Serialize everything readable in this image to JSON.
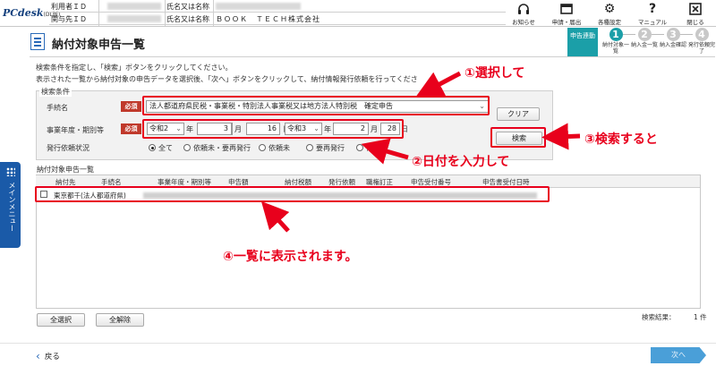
{
  "app": {
    "logo": "PCdesk",
    "logo_sub": "(DL版)"
  },
  "userinfo": {
    "row1_label": "利用者ＩＤ",
    "row1_name_label": "氏名又は名称",
    "row1_name_value": "",
    "row2_label": "関与先ＩＤ",
    "row2_name_label": "氏名又は名称",
    "row2_name_value": "ＢＯＯＫ　ＴＥＣＨ株式会社"
  },
  "toolbar": [
    {
      "label": "お知らせ",
      "icon": "headset-icon"
    },
    {
      "label": "申請・届出",
      "icon": "window-icon"
    },
    {
      "label": "各種設定",
      "icon": "gear-icon"
    },
    {
      "label": "マニュアル",
      "icon": "question-icon"
    },
    {
      "label": "閉じる",
      "icon": "close-icon"
    }
  ],
  "sidebar": {
    "tab_label": "メインメニュー"
  },
  "page": {
    "title": "納付対象申告一覧"
  },
  "steps": {
    "section_label": "申告連動",
    "items": [
      {
        "num": "1",
        "label": "納付対象一覧",
        "active": true
      },
      {
        "num": "2",
        "label": "納入金一覧",
        "active": false
      },
      {
        "num": "3",
        "label": "納入金確認",
        "active": false
      },
      {
        "num": "4",
        "label": "発行依頼完了",
        "active": false
      }
    ]
  },
  "description": {
    "line1": "検索条件を指定し、「検索」ボタンをクリックしてください。",
    "line2": "表示された一覧から納付対象の申告データを選択後、「次へ」ボタンをクリックして、納付情報発行依頼を行ってくださ"
  },
  "search": {
    "panel_title": "検索条件",
    "required_label": "必須",
    "tax_label": "手続名",
    "tax_value": "法人都道府県民税・事業税・特別法人事業税又は地方法人特別税　確定申告",
    "period_label": "事業年度・期別等",
    "from_era": "令和2",
    "from_year": "年",
    "from_month": "3",
    "month_unit": "月",
    "from_day": "16",
    "day_unit": "日",
    "range_sep": "～",
    "to_era": "令和3",
    "to_month": "2",
    "to_day": "28",
    "status_label": "発行依頼状況",
    "status_options": [
      "全て",
      "依頼未・要再発行",
      "依頼未",
      "要再発行",
      "依頼"
    ],
    "status_selected": "全て",
    "clear_button": "クリア",
    "search_button": "検索"
  },
  "list": {
    "title": "納付対象申告一覧",
    "columns": [
      "納付先",
      "手続名",
      "事業年度・期別等",
      "申告額",
      "納付税額",
      "発行依頼",
      "職権訂正",
      "申告受付番号",
      "申告書受付日時"
    ],
    "rows": [
      {
        "payee": "東京都千(法人都道府県)"
      }
    ],
    "select_all": "全選択",
    "deselect_all": "全解除",
    "count_label": "検索結果：",
    "count_value": "1 件"
  },
  "footer": {
    "back_label": "戻る",
    "next_label": "次へ"
  },
  "annotations": {
    "a1": "①選択して",
    "a2": "②日付を入力して",
    "a3": "③検索すると",
    "a4": "④一覧に表示されます。"
  }
}
